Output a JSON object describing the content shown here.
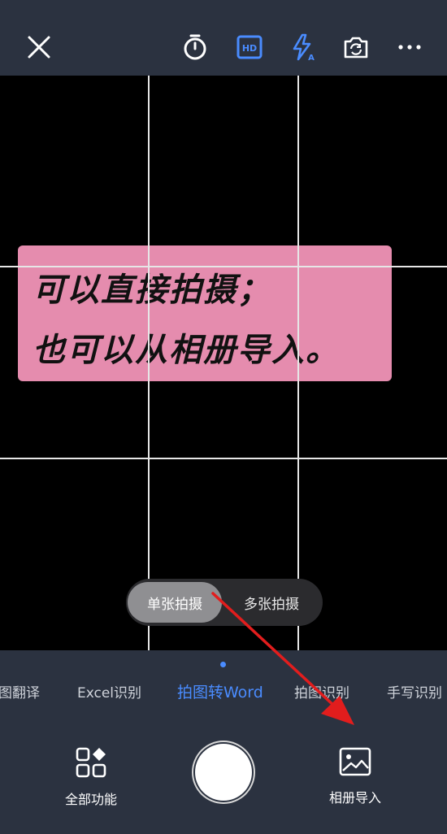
{
  "topbar": {
    "icons": [
      "close-icon",
      "timer-icon",
      "hd-icon",
      "flash-auto-icon",
      "switch-camera-icon",
      "more-icon"
    ],
    "hd_label": "HD",
    "flash_sub": "A",
    "accent": "#4a8cff"
  },
  "subject": {
    "line1": "可以直接拍摄；",
    "line2": "也可以从相册导入。",
    "color": "#e58cae"
  },
  "capture_mode": {
    "single": "单张拍摄",
    "multi": "多张拍摄",
    "selected": "单张拍摄"
  },
  "mode_tabs": [
    {
      "label": "图翻译"
    },
    {
      "label": "Excel识别"
    },
    {
      "label": "拍图转Word",
      "active": true
    },
    {
      "label": "拍图识别"
    },
    {
      "label": "手写识别"
    }
  ],
  "bottom": {
    "all_features": "全部功能",
    "album_import": "相册导入"
  }
}
